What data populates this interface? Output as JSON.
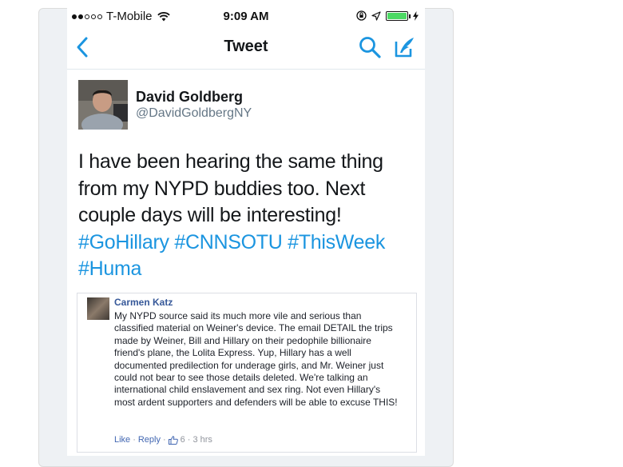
{
  "status_bar": {
    "carrier": "T-Mobile",
    "time": "9:09 AM",
    "signal_bars": 2,
    "signal_total": 5,
    "battery_level": 1.0
  },
  "nav": {
    "title": "Tweet",
    "back_icon": "chevron-left-icon",
    "search_icon": "search-icon",
    "compose_icon": "compose-icon",
    "accent_color": "#1b95e0"
  },
  "tweet": {
    "author_name": "David Goldberg",
    "author_handle": "@DavidGoldbergNY",
    "text_lines": [
      "I have been hearing the same thing",
      "from my NYPD buddies too. Next",
      "couple days will be interesting!"
    ],
    "hashtags_line1": [
      "#GoHillary",
      "#CNNSOTU",
      "#ThisWeek"
    ],
    "hashtags_line2": [
      "#Huma"
    ],
    "hashtag_color": "#1b95e0"
  },
  "embedded_comment": {
    "author": "Carmen Katz",
    "text": "My NYPD source said its much more vile and serious than classified material on Weiner's device. The email DETAIL the trips made by Weiner, Bill and Hillary on their pedophile billionaire friend's plane, the Lolita Express. Yup, Hillary has a well documented predilection for underage girls, and Mr. Weiner just could not bear to see those details deleted. We're talking an international child enslavement and sex ring. Not even Hillary's most ardent supporters and defenders will be able to excuse THIS!",
    "like_label": "Like",
    "reply_label": "Reply",
    "separator": "·",
    "like_count": "6",
    "time": "3 hrs",
    "name_color": "#365899"
  }
}
